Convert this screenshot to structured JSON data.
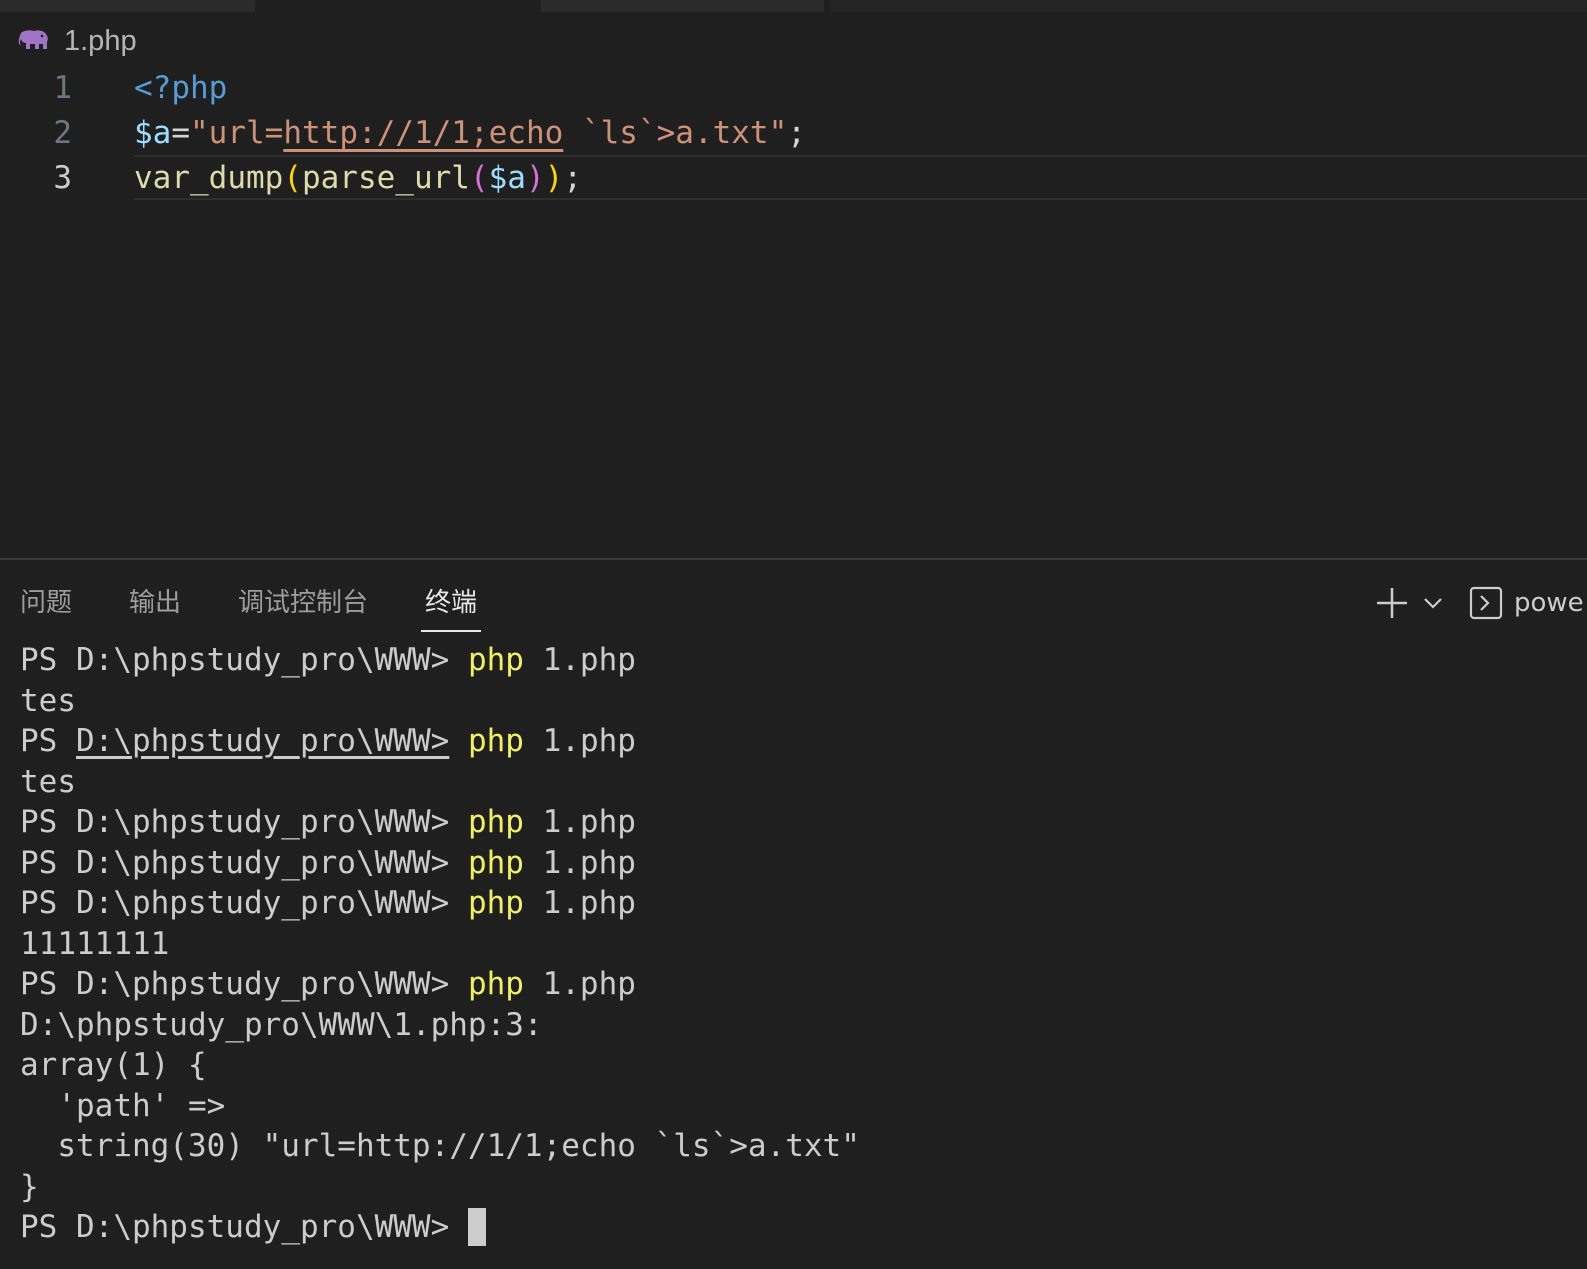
{
  "breadcrumb": {
    "icon": "php-elephant-icon",
    "file_name": "1.php"
  },
  "colors": {
    "background": "#1f1f1f",
    "keyword_blue": "#569cd6",
    "variable": "#9cdcfe",
    "string": "#ce9178",
    "function": "#dcdcaa",
    "bracket_yellow": "#ffd700",
    "bracket_pink": "#da70d6",
    "terminal_command": "#f0f060"
  },
  "editor": {
    "lines": [
      {
        "number": "1",
        "tokens": {
          "t1": "<?php"
        }
      },
      {
        "number": "2",
        "tokens": {
          "t1": "$a",
          "t2": "=",
          "t3": "\"url=",
          "t4": "http://1/1;echo",
          "t5": " `ls`>a.txt\"",
          "t6": ";"
        }
      },
      {
        "number": "3",
        "tokens": {
          "t1": "var_dump",
          "t2": "(",
          "t3": "parse_url",
          "t4": "(",
          "t5": "$a",
          "t6": ")",
          "t7": ")",
          "t8": ";"
        }
      }
    ]
  },
  "panel": {
    "tabs": [
      "问题",
      "输出",
      "调试控制台",
      "终端"
    ],
    "active_tab": "终端",
    "shell_label": "powe"
  },
  "terminal": {
    "prompt": "PS D:\\phpstudy_pro\\WWW> ",
    "prompt_prefix": "PS ",
    "prompt_path": "D:\\phpstudy_pro\\WWW>",
    "cmd": "php",
    "arg": " 1.php",
    "output": {
      "tes1": "tes",
      "tes2": "tes",
      "ones": "11111111",
      "loc": "D:\\phpstudy_pro\\WWW\\1.php:3:",
      "arr_open": "array(1) {",
      "key": "  'path' =>",
      "val": "  string(30) \"url=http://1/1;echo `ls`>a.txt\"",
      "arr_close": "}"
    }
  }
}
